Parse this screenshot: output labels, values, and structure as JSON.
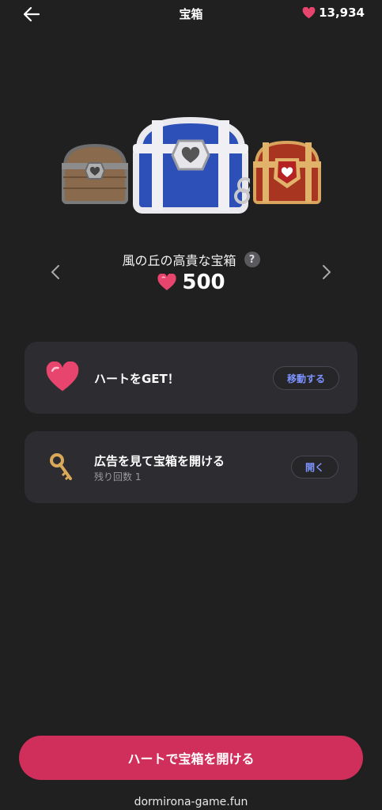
{
  "header": {
    "title": "宝箱",
    "heart_count": "13,934"
  },
  "chest": {
    "name": "風の丘の高貴な宝箱",
    "help": "?",
    "price": "500"
  },
  "cards": {
    "get_hearts": {
      "label": "ハートをGET！",
      "button": "移動する"
    },
    "ad_open": {
      "label": "広告を見て宝箱を開ける",
      "remaining": "残り回数 1",
      "button": "開く"
    }
  },
  "main_button": "ハートで宝箱を開ける",
  "footer_url": "dormirona-game.fun",
  "colors": {
    "background": "#202021",
    "card": "#2c2c31",
    "accent_button": "#cf2f5a",
    "link_blue": "#7d93ff",
    "heart_pink": "#e8456e"
  },
  "icons": [
    "back-arrow-icon",
    "heart-icon",
    "help-icon",
    "chevron-left-icon",
    "chevron-right-icon",
    "key-icon"
  ]
}
